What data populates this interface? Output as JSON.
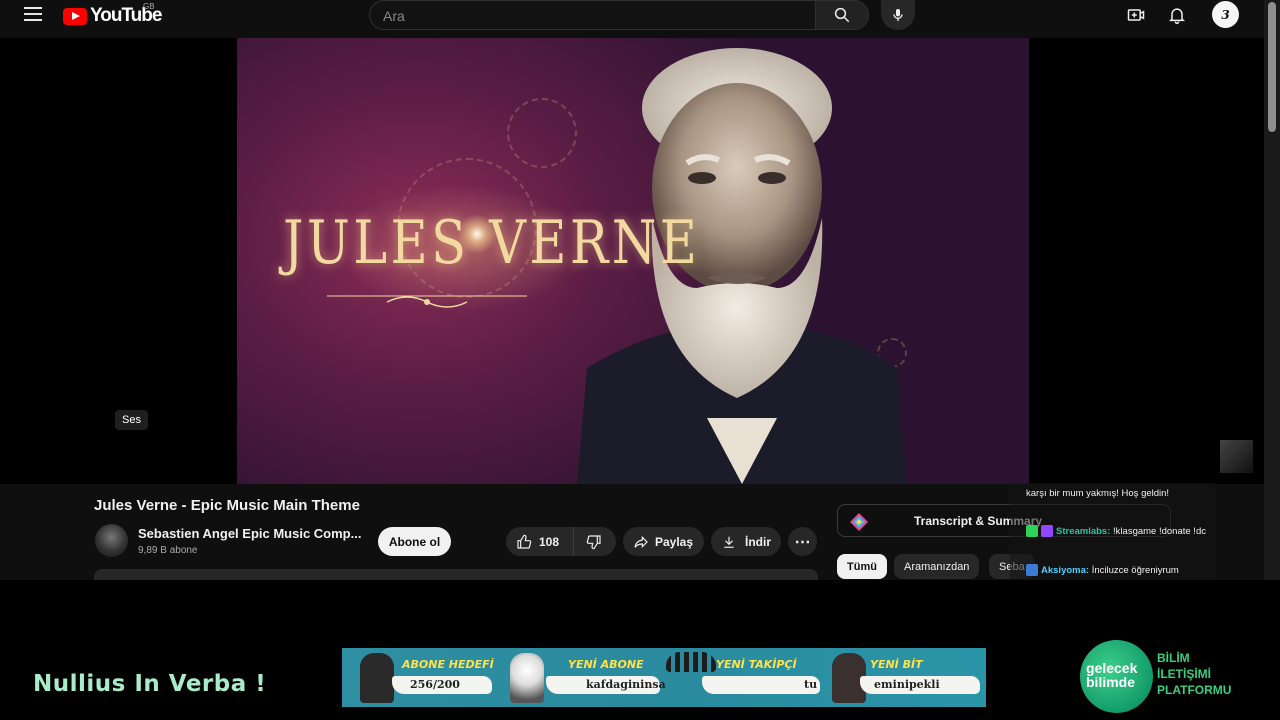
{
  "header": {
    "logo_text": "YouTube",
    "country_code": "GB",
    "search_placeholder": "Ara"
  },
  "player": {
    "title_art": "JULES VERNE",
    "audio_chip": "Ses"
  },
  "video": {
    "title": "Jules Verne - Epic Music Main Theme",
    "channel_name": "Sebastien Angel Epic Music Comp...",
    "subscribers": "9,89 B abone",
    "subscribe_label": "Abone ol",
    "like_count": "108",
    "share_label": "Paylaş",
    "download_label": "İndir",
    "more_label": "⋯"
  },
  "sidebar": {
    "transcript_label": "Transcript & Summary",
    "chips": [
      {
        "label": "Tümü",
        "active": true
      },
      {
        "label": "Aramanızdan",
        "active": false
      },
      {
        "label": "Seba",
        "active": false
      }
    ]
  },
  "chat": {
    "lines": [
      {
        "user": "",
        "text": "karşı bir mum yakmış! Hoş geldin!"
      },
      {
        "user": "Streamlabs:",
        "text": "!klasgame !donate !dc"
      },
      {
        "user": "Aksiyoma:",
        "text": "İnciluzce öğreniyrum"
      }
    ]
  },
  "overlay": {
    "motto": "Nullius In Verba !",
    "goals": [
      {
        "title": "ABONE HEDEFİ",
        "value": "256/200"
      },
      {
        "title": "YENİ ABONE",
        "value": "kafdagininsa"
      },
      {
        "title": "YENİ TAKİPÇİ",
        "value": "tu"
      },
      {
        "title": "YENİ BİT",
        "value": "eminipekli"
      }
    ],
    "brand_logo_line1": "gelecek",
    "brand_logo_line2": "bilimde",
    "brand_right_1": "BİLİM",
    "brand_right_2": "İLETİŞİMİ",
    "brand_right_3": "PLATFORMU"
  },
  "colors": {
    "accent_red": "#ff0000",
    "motto_green": "#a8ecc9",
    "goal_yellow": "#ffe24a",
    "brand_green": "#39d07e",
    "chat_name_blue": "#4fd1ff"
  },
  "icons": [
    "menu-icon",
    "search-icon",
    "mic-icon",
    "create-icon",
    "bell-icon",
    "like-icon",
    "dislike-icon",
    "share-icon",
    "download-icon",
    "more-icon"
  ]
}
